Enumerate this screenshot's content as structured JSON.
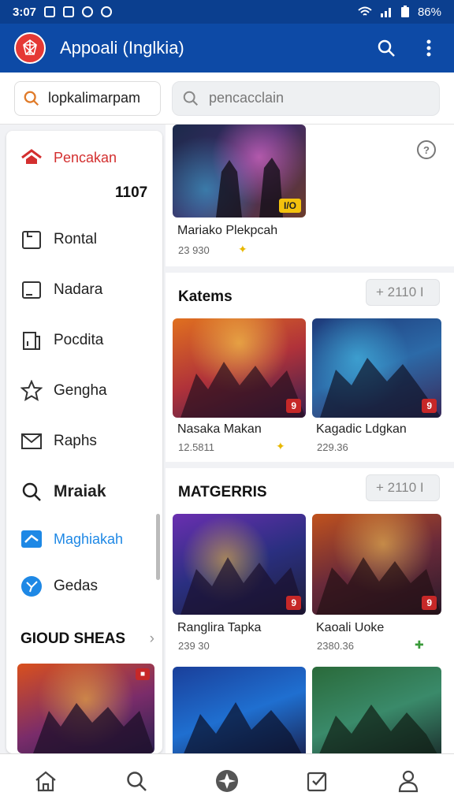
{
  "status": {
    "time": "3:07",
    "battery": "86%"
  },
  "appbar": {
    "title": "Appoali (Inglkia)"
  },
  "search": {
    "field1_value": "lopkalimarpam",
    "field2_placeholder": "pencacclain"
  },
  "sidebar": {
    "items": [
      {
        "label": "Pencakan",
        "icon": "home-icon",
        "active_color": "#d32f2f"
      },
      {
        "label": "Rontal",
        "icon": "folder-icon"
      },
      {
        "label": "Nadara",
        "icon": "tablet-icon"
      },
      {
        "label": "Pocdita",
        "icon": "bookmark-icon"
      },
      {
        "label": "Gengha",
        "icon": "star-icon"
      },
      {
        "label": "Raphs",
        "icon": "mail-icon"
      },
      {
        "label": "Mraiak",
        "icon": "search-icon"
      },
      {
        "label": "Maghiakah",
        "icon": "message-icon",
        "active_color": "#1e88e5"
      },
      {
        "label": "Gedas",
        "icon": "compass-icon"
      }
    ],
    "count": "1107",
    "section_title": "GIOUD SHEAS"
  },
  "main": {
    "featured": {
      "title": "Mariako Plekpcah",
      "meta": "23 930",
      "badge": "I/O"
    },
    "section1": {
      "title": "Katems",
      "chip": "+ 2110 I",
      "games": [
        {
          "title": "Nasaka Makan",
          "meta": "12.5811",
          "badge": "9"
        },
        {
          "title": "Kagadic Ldgkan",
          "meta": "229.36",
          "badge": "9"
        }
      ]
    },
    "section2": {
      "title": "MATGERRIS",
      "chip": "+ 2110 I",
      "games": [
        {
          "title": "Ranglira Tapka",
          "meta": "239 30",
          "badge": "9"
        },
        {
          "title": "Kaoali Uoke",
          "meta": "2380.36",
          "badge": "9"
        }
      ]
    }
  },
  "colors": {
    "appbar": "#0d4aa6",
    "statusbar": "#0b3f8f",
    "accent_red": "#d32f2f",
    "accent_blue": "#1e88e5"
  }
}
